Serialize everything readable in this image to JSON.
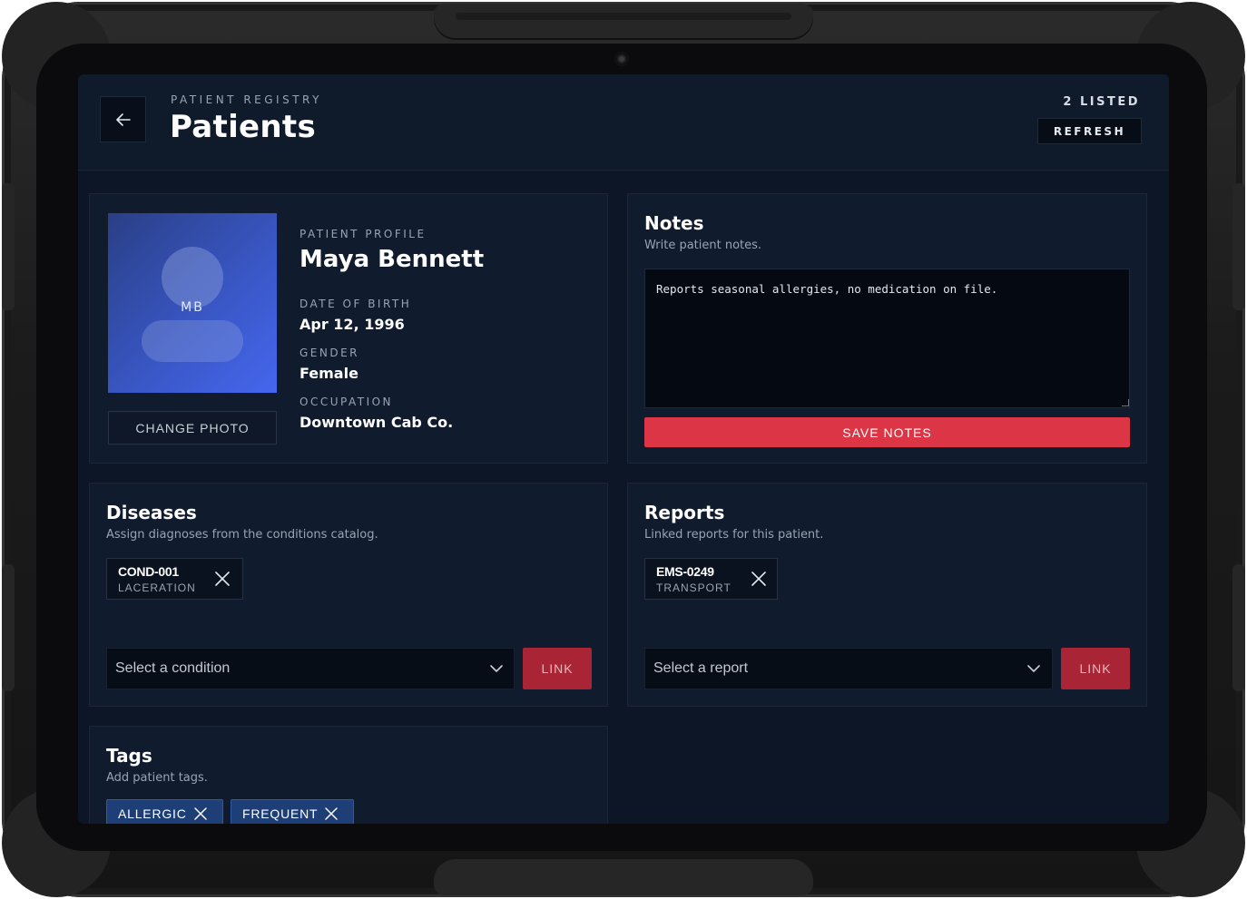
{
  "header": {
    "eyebrow": "PATIENT REGISTRY",
    "title": "Patients",
    "count_label": "2 LISTED",
    "refresh_label": "REFRESH"
  },
  "profile": {
    "eyebrow": "PATIENT PROFILE",
    "name": "Maya Bennett",
    "initials": "MB",
    "change_photo_label": "CHANGE PHOTO",
    "fields": [
      {
        "label": "DATE OF BIRTH",
        "value": "Apr 12, 1996"
      },
      {
        "label": "GENDER",
        "value": "Female"
      },
      {
        "label": "OCCUPATION",
        "value": "Downtown Cab Co."
      }
    ]
  },
  "notes": {
    "title": "Notes",
    "subtitle": "Write patient notes.",
    "value": "Reports seasonal allergies, no medication on file.",
    "save_label": "SAVE NOTES"
  },
  "diseases": {
    "title": "Diseases",
    "subtitle": "Assign diagnoses from the conditions catalog.",
    "chips": [
      {
        "code": "COND-001",
        "name": "LACERATION"
      }
    ],
    "select_placeholder": "Select a condition",
    "link_label": "LINK"
  },
  "reports": {
    "title": "Reports",
    "subtitle": "Linked reports for this patient.",
    "chips": [
      {
        "code": "EMS-0249",
        "name": "TRANSPORT"
      }
    ],
    "select_placeholder": "Select a report",
    "link_label": "LINK"
  },
  "tags": {
    "title": "Tags",
    "subtitle": "Add patient tags.",
    "items": [
      {
        "label": "ALLERGIC"
      },
      {
        "label": "FREQUENT"
      }
    ]
  },
  "colors": {
    "accent_red": "#dc3545",
    "link_red": "#a92535",
    "tag_blue": "#1e3e78",
    "screen_bg": "#0c1626",
    "card_bg": "#101b2d"
  },
  "icons": {
    "back": "arrow-left-icon",
    "remove": "close-icon",
    "dropdown": "chevron-down-icon"
  }
}
